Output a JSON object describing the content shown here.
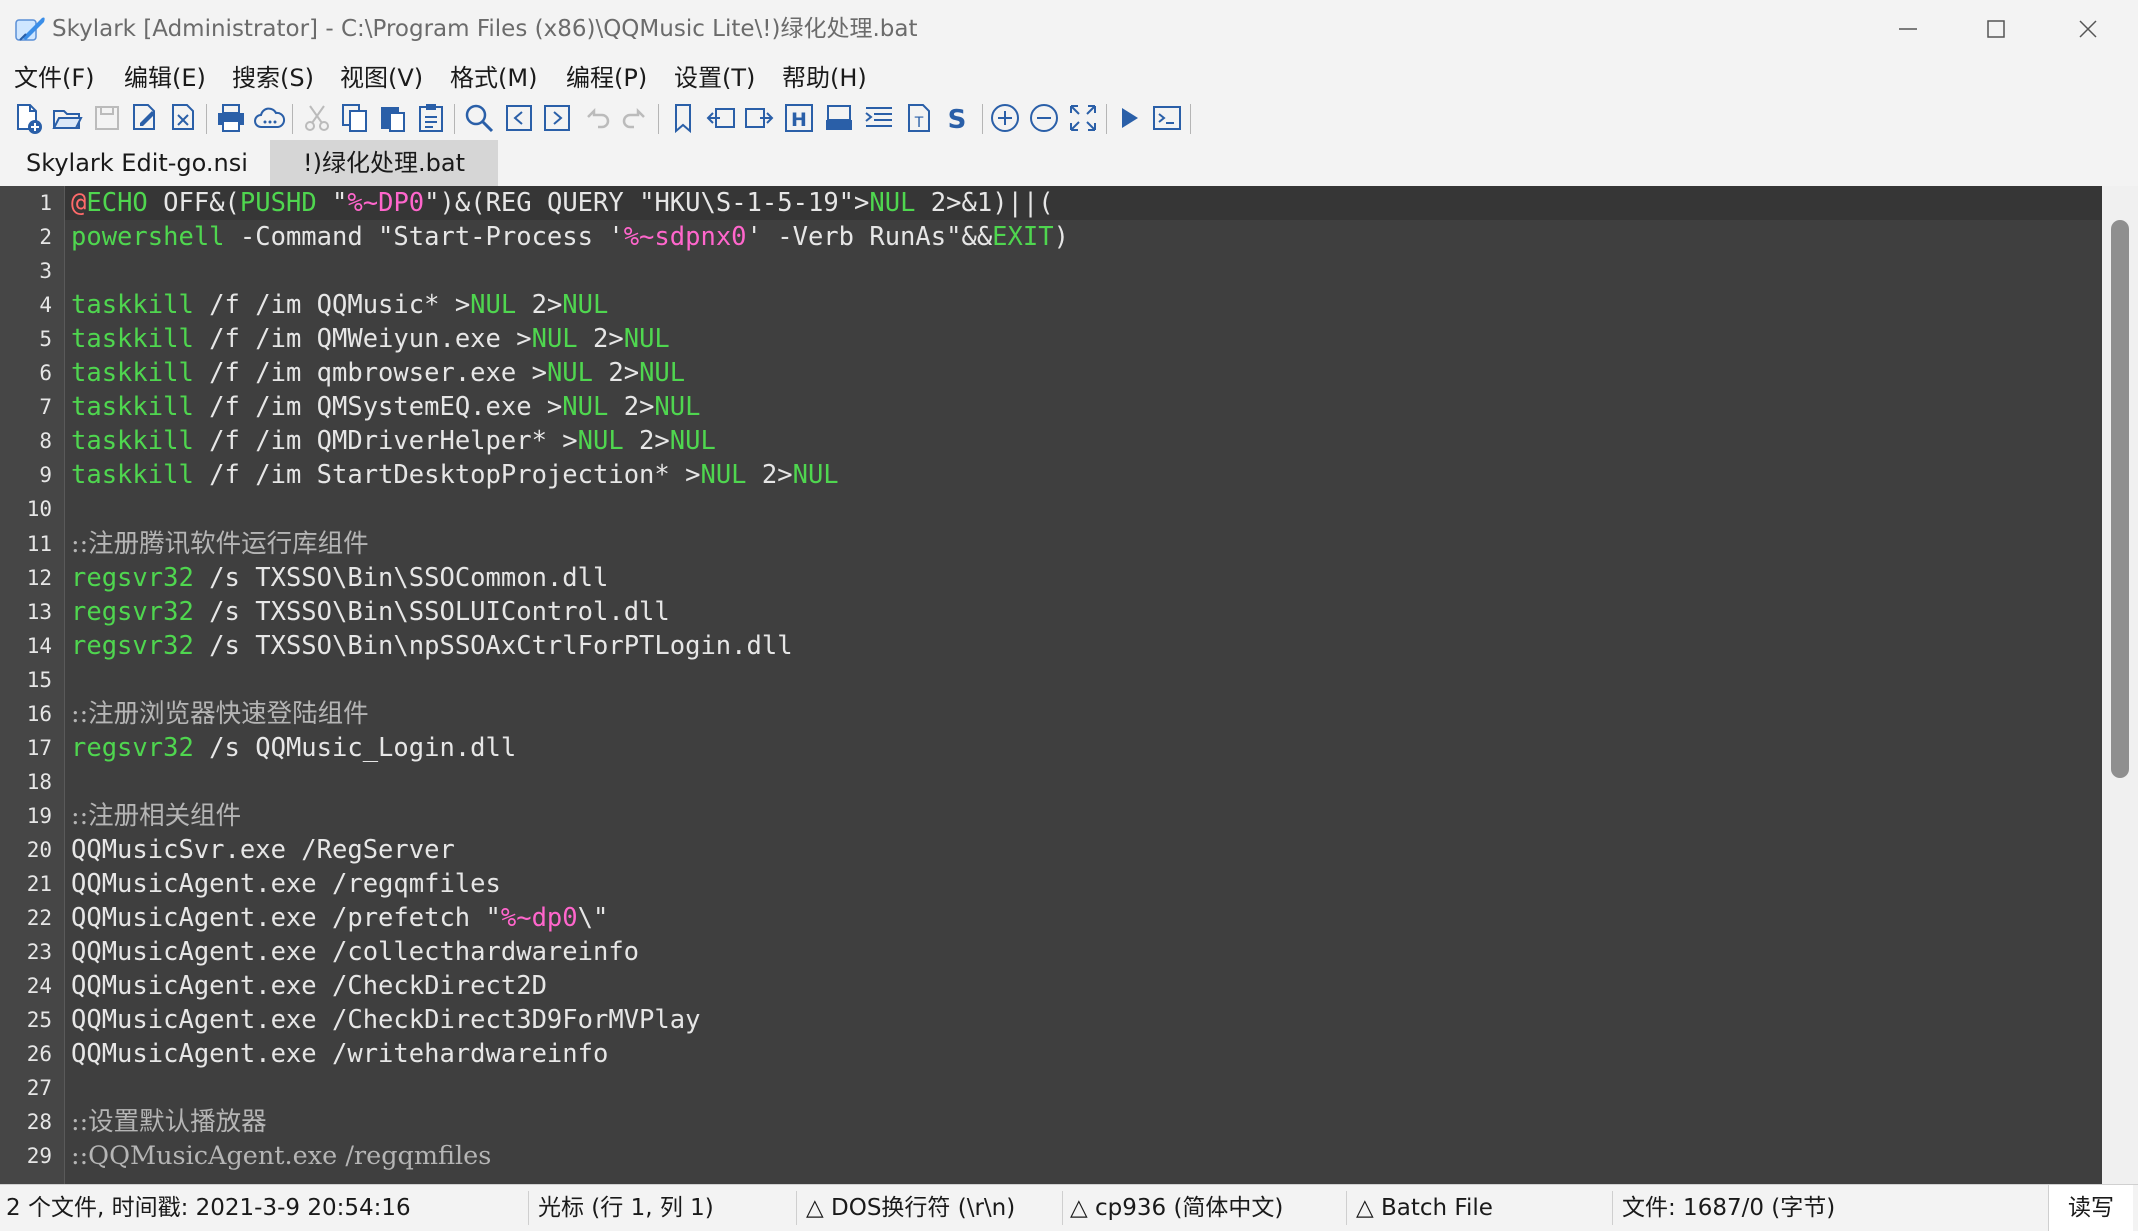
{
  "window": {
    "title": "Skylark [Administrator] - C:\\Program Files (x86)\\QQMusic Lite\\!)绿化处理.bat"
  },
  "menu": [
    "文件(F)",
    "编辑(E)",
    "搜索(S)",
    "视图(V)",
    "格式(M)",
    "编程(P)",
    "设置(T)",
    "帮助(H)"
  ],
  "toolbar_icons": [
    "new-file",
    "open",
    "save",
    "save-as",
    "close-file",
    "print",
    "cloud",
    "cut",
    "copy",
    "paste",
    "clipboard",
    "find",
    "prev",
    "next",
    "undo",
    "redo",
    "bookmark",
    "indent-left",
    "indent-right",
    "hex",
    "printer-2",
    "wrap",
    "text-file",
    "s-tool",
    "zoom-in",
    "zoom-out",
    "fullscreen",
    "run",
    "console"
  ],
  "tabs": [
    {
      "label": "Skylark Edit-go.nsi",
      "active": false
    },
    {
      "label": "!)绿化处理.bat",
      "active": true
    }
  ],
  "editor": {
    "lines": [
      {
        "n": "1",
        "parts": [
          [
            "ex",
            "@"
          ],
          [
            "kw",
            "ECHO"
          ],
          [
            "",
            " OFF&("
          ],
          [
            "kw",
            "PUSHD"
          ],
          [
            "",
            " \""
          ],
          [
            "var",
            "%~DP0"
          ],
          [
            "",
            "\")&(REG QUERY \"HKU\\S-1-5-19\">"
          ],
          [
            "kw",
            "NUL"
          ],
          [
            "",
            " 2>&1)||("
          ]
        ]
      },
      {
        "n": "2",
        "parts": [
          [
            "kw",
            "powershell"
          ],
          [
            "",
            " -Command \"Start-Process '"
          ],
          [
            "var",
            "%~sdpnx0"
          ],
          [
            "",
            "' -Verb RunAs\"&&"
          ],
          [
            "kw",
            "EXIT"
          ],
          [
            "",
            ")"
          ]
        ]
      },
      {
        "n": "3",
        "parts": []
      },
      {
        "n": "4",
        "parts": [
          [
            "kw",
            "taskkill"
          ],
          [
            "",
            " /f /im QQMusic* >"
          ],
          [
            "kw",
            "NUL"
          ],
          [
            "",
            " 2>"
          ],
          [
            "kw",
            "NUL"
          ]
        ]
      },
      {
        "n": "5",
        "parts": [
          [
            "kw",
            "taskkill"
          ],
          [
            "",
            " /f /im QMWeiyun.exe >"
          ],
          [
            "kw",
            "NUL"
          ],
          [
            "",
            " 2>"
          ],
          [
            "kw",
            "NUL"
          ]
        ]
      },
      {
        "n": "6",
        "parts": [
          [
            "kw",
            "taskkill"
          ],
          [
            "",
            " /f /im qmbrowser.exe >"
          ],
          [
            "kw",
            "NUL"
          ],
          [
            "",
            " 2>"
          ],
          [
            "kw",
            "NUL"
          ]
        ]
      },
      {
        "n": "7",
        "parts": [
          [
            "kw",
            "taskkill"
          ],
          [
            "",
            " /f /im QMSystemEQ.exe >"
          ],
          [
            "kw",
            "NUL"
          ],
          [
            "",
            " 2>"
          ],
          [
            "kw",
            "NUL"
          ]
        ]
      },
      {
        "n": "8",
        "parts": [
          [
            "kw",
            "taskkill"
          ],
          [
            "",
            " /f /im QMDriverHelper* >"
          ],
          [
            "kw",
            "NUL"
          ],
          [
            "",
            " 2>"
          ],
          [
            "kw",
            "NUL"
          ]
        ]
      },
      {
        "n": "9",
        "parts": [
          [
            "kw",
            "taskkill"
          ],
          [
            "",
            " /f /im StartDesktopProjection* >"
          ],
          [
            "kw",
            "NUL"
          ],
          [
            "",
            " 2>"
          ],
          [
            "kw",
            "NUL"
          ]
        ]
      },
      {
        "n": "10",
        "parts": []
      },
      {
        "n": "11",
        "parts": [
          [
            "cm",
            "::注册腾讯软件运行库组件"
          ]
        ]
      },
      {
        "n": "12",
        "parts": [
          [
            "kw",
            "regsvr32"
          ],
          [
            "",
            " /s TXSSO\\Bin\\SSOCommon.dll"
          ]
        ]
      },
      {
        "n": "13",
        "parts": [
          [
            "kw",
            "regsvr32"
          ],
          [
            "",
            " /s TXSSO\\Bin\\SSOLUIControl.dll"
          ]
        ]
      },
      {
        "n": "14",
        "parts": [
          [
            "kw",
            "regsvr32"
          ],
          [
            "",
            " /s TXSSO\\Bin\\npSSOAxCtrlForPTLogin.dll"
          ]
        ]
      },
      {
        "n": "15",
        "parts": []
      },
      {
        "n": "16",
        "parts": [
          [
            "cm",
            "::注册浏览器快速登陆组件"
          ]
        ]
      },
      {
        "n": "17",
        "parts": [
          [
            "kw",
            "regsvr32"
          ],
          [
            "",
            " /s QQMusic_Login.dll"
          ]
        ]
      },
      {
        "n": "18",
        "parts": []
      },
      {
        "n": "19",
        "parts": [
          [
            "cm",
            "::注册相关组件"
          ]
        ]
      },
      {
        "n": "20",
        "parts": [
          [
            "",
            "QQMusicSvr.exe /RegServer"
          ]
        ]
      },
      {
        "n": "21",
        "parts": [
          [
            "",
            "QQMusicAgent.exe /regqmfiles"
          ]
        ]
      },
      {
        "n": "22",
        "parts": [
          [
            "",
            "QQMusicAgent.exe /prefetch \""
          ],
          [
            "var",
            "%~dp0"
          ],
          [
            "",
            "\\\""
          ]
        ]
      },
      {
        "n": "23",
        "parts": [
          [
            "",
            "QQMusicAgent.exe /collecthardwareinfo"
          ]
        ]
      },
      {
        "n": "24",
        "parts": [
          [
            "",
            "QQMusicAgent.exe /CheckDirect2D"
          ]
        ]
      },
      {
        "n": "25",
        "parts": [
          [
            "",
            "QQMusicAgent.exe /CheckDirect3D9ForMVPlay"
          ]
        ]
      },
      {
        "n": "26",
        "parts": [
          [
            "",
            "QQMusicAgent.exe /writehardwareinfo"
          ]
        ]
      },
      {
        "n": "27",
        "parts": []
      },
      {
        "n": "28",
        "parts": [
          [
            "cm",
            "::设置默认播放器"
          ]
        ]
      },
      {
        "n": "29",
        "parts": [
          [
            "cm",
            "::QQMusicAgent.exe /regqmfiles"
          ]
        ]
      }
    ]
  },
  "status": {
    "files": "2 个文件, 时间戳: 2021-3-9 20:54:16",
    "cursor": "光标 (行 1, 列 1)",
    "eol": "△ DOS换行符 (\\r\\n)",
    "encoding": "△ cp936 (简体中文)",
    "filetype": "△ Batch File",
    "size": "文件: 1687/0 (字节)",
    "mode": "读写"
  },
  "colors": {
    "editor_bg": "#3f3f3f",
    "gutter_bg": "#464646",
    "keyword": "#4fd64f",
    "variable": "#ff66cc",
    "echo_at": "#ff6a6a",
    "comment": "#b5b5b5",
    "text": "#e6e6e6"
  }
}
